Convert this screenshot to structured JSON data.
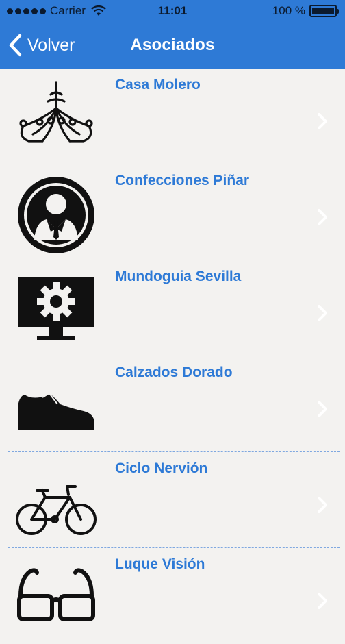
{
  "status": {
    "carrier": "Carrier",
    "time": "11:01",
    "battery": "100 %"
  },
  "nav": {
    "back_label": "Volver",
    "title": "Asociados"
  },
  "items": [
    {
      "name": "Casa Molero",
      "icon": "chandelier-icon"
    },
    {
      "name": "Confecciones Piñar",
      "icon": "businessman-icon"
    },
    {
      "name": "Mundoguia Sevilla",
      "icon": "monitor-gear-icon"
    },
    {
      "name": "Calzados Dorado",
      "icon": "shoe-icon"
    },
    {
      "name": "Ciclo Nervión",
      "icon": "bicycle-icon"
    },
    {
      "name": "Luque Visión",
      "icon": "glasses-icon"
    }
  ],
  "colors": {
    "accent": "#2e7ad6",
    "background": "#f3f2f0",
    "divider": "#7fa8e0"
  }
}
